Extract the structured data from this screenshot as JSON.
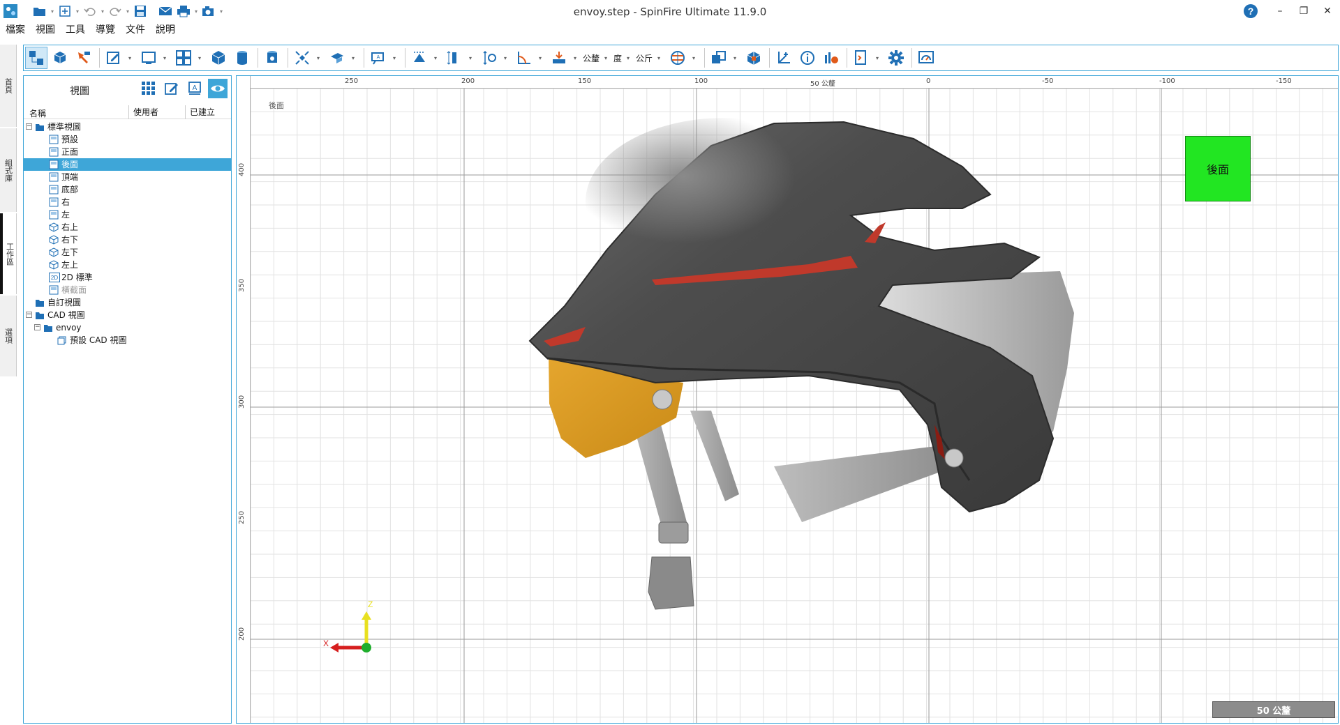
{
  "window": {
    "title": "envoy.step - SpinFire Ultimate 11.9.0",
    "help_label": "?",
    "minimize": "–",
    "restore": "❐",
    "close": "✕"
  },
  "menu": [
    "檔案",
    "視圖",
    "工具",
    "導覽",
    "文件",
    "說明"
  ],
  "side_tabs": [
    "首頁",
    "組式庫",
    "工作區",
    "選項"
  ],
  "toolbar": {
    "tolerance_label": "公釐",
    "angle_label": "度",
    "mass_label": "公斤"
  },
  "panel": {
    "title": "視圖",
    "columns": [
      "名稱",
      "使用者",
      "已建立"
    ],
    "tree": [
      {
        "label": "標準視圖",
        "level": 0,
        "type": "folder",
        "expand": "−"
      },
      {
        "label": "預設",
        "level": 1,
        "type": "view"
      },
      {
        "label": "正面",
        "level": 1,
        "type": "view"
      },
      {
        "label": "後面",
        "level": 1,
        "type": "view",
        "selected": true
      },
      {
        "label": "頂端",
        "level": 1,
        "type": "view"
      },
      {
        "label": "底部",
        "level": 1,
        "type": "view"
      },
      {
        "label": "右",
        "level": 1,
        "type": "view"
      },
      {
        "label": "左",
        "level": 1,
        "type": "view"
      },
      {
        "label": "右上",
        "level": 1,
        "type": "iso"
      },
      {
        "label": "右下",
        "level": 1,
        "type": "iso"
      },
      {
        "label": "左下",
        "level": 1,
        "type": "iso"
      },
      {
        "label": "左上",
        "level": 1,
        "type": "iso"
      },
      {
        "label": "2D 標準",
        "level": 1,
        "type": "2d"
      },
      {
        "label": "橫截面",
        "level": 1,
        "type": "view",
        "dim": true
      },
      {
        "label": "自訂視圖",
        "level": 0,
        "type": "folder",
        "expand": ""
      },
      {
        "label": "CAD 視圖",
        "level": 0,
        "type": "folder",
        "expand": "−"
      },
      {
        "label": "envoy",
        "level": 1,
        "type": "folder",
        "expand": "−"
      },
      {
        "label": "預設 CAD 視圖",
        "level": 2,
        "type": "cad"
      }
    ]
  },
  "viewport": {
    "view_label": "後面",
    "navcube_label": "後面",
    "scale_label": "50 公釐",
    "axis_x": "X",
    "axis_z": "Z",
    "hruler_labels": [
      "250",
      "200",
      "150",
      "100",
      "50 公釐",
      "0",
      "-50",
      "-100",
      "-150"
    ],
    "vruler_labels": [
      "400",
      "350",
      "300",
      "250",
      "200"
    ]
  }
}
